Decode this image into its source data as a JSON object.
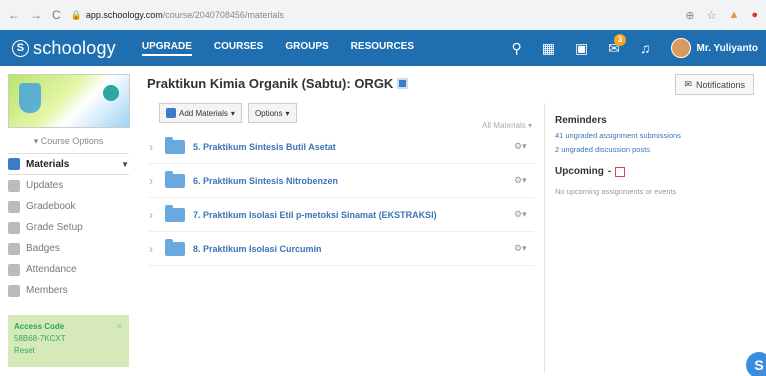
{
  "browser": {
    "url_domain": "app.schoology.com",
    "url_path": "/course/2040708456/materials"
  },
  "topbar": {
    "logo": "schoology",
    "nav": [
      "UPGRADE",
      "COURSES",
      "GROUPS",
      "RESOURCES"
    ],
    "message_badge": "3",
    "user_name": "Mr. Yuliyanto"
  },
  "sidebar": {
    "course_options": "Course Options",
    "items": [
      {
        "label": "Materials",
        "active": true
      },
      {
        "label": "Updates"
      },
      {
        "label": "Gradebook"
      },
      {
        "label": "Grade Setup"
      },
      {
        "label": "Badges"
      },
      {
        "label": "Attendance"
      },
      {
        "label": "Members"
      }
    ],
    "access": {
      "title": "Access Code",
      "code": "58B68-7KCXT",
      "reset": "Reset"
    }
  },
  "main": {
    "title": "Praktikun Kimia Organik (Sabtu): ORGK",
    "notifications": "Notifications",
    "add_materials": "Add Materials",
    "options": "Options",
    "all_materials": "All Materials",
    "folders": [
      "5. Praktikum Sintesis Butil Asetat",
      "6. Praktikum Sintesis Nitrobenzen",
      "7. Praktikum Isolasi Etil p-metoksi Sinamat (EKSTRAKSI)",
      "8. Praktikum Isolasi Curcumin"
    ]
  },
  "right": {
    "reminders": "Reminders",
    "reminder_links": [
      "41 ungraded assignment submissions",
      "2 ungraded discussion posts"
    ],
    "upcoming": "Upcoming",
    "none": "No upcoming assignments or events"
  },
  "colors": {
    "topbar": "#1f6fb0",
    "link": "#3a75b5"
  }
}
